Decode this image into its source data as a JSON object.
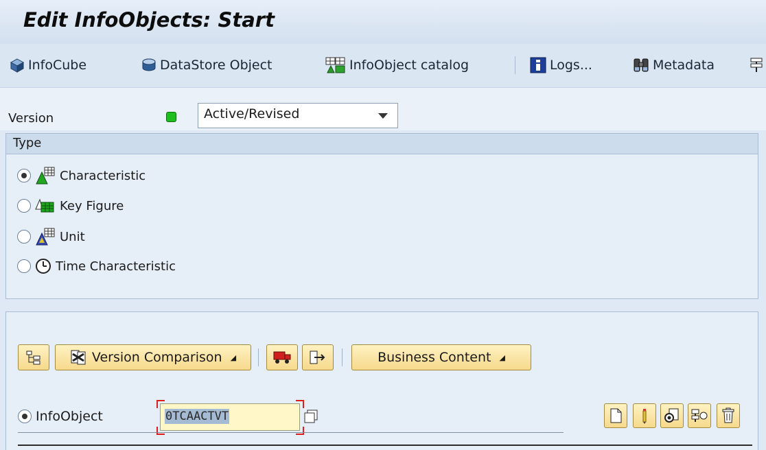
{
  "window": {
    "title": "Edit InfoObjects: Start"
  },
  "toolbar": {
    "infocube": "InfoCube",
    "datastore": "DataStore Object",
    "catalog": "InfoObject catalog",
    "logs": "Logs...",
    "metadata": "Metadata"
  },
  "version": {
    "label": "Version",
    "selected": "Active/Revised",
    "status_color": "#1fbe1f"
  },
  "type_group": {
    "title": "Type",
    "options": [
      {
        "label": "Characteristic",
        "checked": true
      },
      {
        "label": "Key Figure",
        "checked": false
      },
      {
        "label": "Unit",
        "checked": false
      },
      {
        "label": "Time Characteristic",
        "checked": false
      }
    ]
  },
  "actions": {
    "version_comparison": "Version Comparison",
    "business_content": "Business Content"
  },
  "infoobject": {
    "label": "InfoObject",
    "value": "0TCAACTVT"
  },
  "colors": {
    "accent_button": "#f6d98c",
    "panel_bg": "#e6eef8",
    "required_marker": "#e21b1b"
  }
}
